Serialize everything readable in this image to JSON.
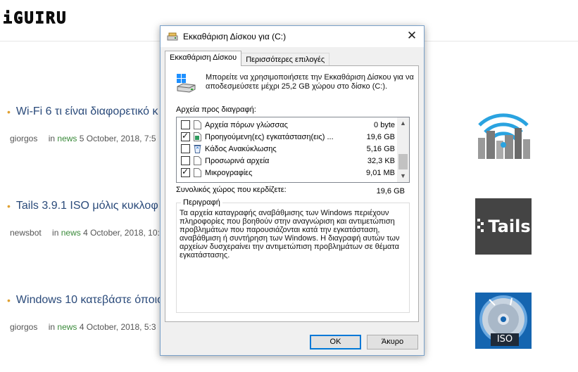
{
  "site": {
    "logo": "iGUIRU",
    "articles": [
      {
        "title": "Wi-Fi 6 τι είναι διαφορετικό κ",
        "author": "giorgos",
        "category_prefix": "in",
        "category": "news",
        "date": "5 October, 2018, 7:5"
      },
      {
        "title": "Tails 3.9.1 ISO μόλις κυκλοφ",
        "author": "newsbot",
        "category_prefix": "in",
        "category": "news",
        "date": "4 October, 2018, 10:"
      },
      {
        "title": "Windows 10 κατεβάστε όποιο",
        "author": "giorgos",
        "category_prefix": "in",
        "category": "news",
        "date": "4 October, 2018, 5:3"
      }
    ],
    "thumbnails": {
      "tails_text": "Tails",
      "iso_text": "ISO"
    }
  },
  "dialog": {
    "title": "Εκκαθάριση Δίσκου για  (C:)",
    "tabs": [
      {
        "label": "Εκκαθάριση Δίσκου",
        "active": true
      },
      {
        "label": "Περισσότερες επιλογές",
        "active": false
      }
    ],
    "intro_text": "Μπορείτε να χρησιμοποιήσετε την Εκκαθάριση Δίσκου για να αποδεσμεύσετε μέχρι 25,2 GB χώρου στο δίσκο  (C:).",
    "files_label": "Αρχεία προς διαγραφή:",
    "files": [
      {
        "name": "Αρχεία πόρων γλώσσας",
        "size": "0 byte",
        "checked": false,
        "icon": "file-icon"
      },
      {
        "name": "Προηγούμενη(ες) εγκατάσταση(εις) ...",
        "size": "19,6 GB",
        "checked": true,
        "icon": "windows-file-icon"
      },
      {
        "name": "Κάδος Ανακύκλωσης",
        "size": "5,16 GB",
        "checked": false,
        "icon": "recycle-bin-icon"
      },
      {
        "name": "Προσωρινά αρχεία",
        "size": "32,3 KB",
        "checked": false,
        "icon": "file-icon"
      },
      {
        "name": "Μικρογραφίες",
        "size": "9,01 MB",
        "checked": true,
        "icon": "file-icon"
      }
    ],
    "total_label": "Συνολικός χώρος που κερδίζετε:",
    "total_value": "19,6 GB",
    "description_label": "Περιγραφή",
    "description_text": "Τα αρχεία καταγραφής αναβάθμισης των Windows περιέχουν πληροφορίες που βοηθούν στην αναγνώριση και αντιμετώπιση προβλημάτων που παρουσιάζονται κατά την εγκατάσταση, αναβάθμιση ή συντήρηση των Windows. Η διαγραφή αυτών των αρχείων δυσχεραίνει την αντιμετώπιση προβλημάτων σε θέματα εγκατάστασης.",
    "ok_label": "OK",
    "cancel_label": "Άκυρο"
  },
  "colors": {
    "accent": "#0078d7",
    "link": "#2a4a7a",
    "bullet": "#e0a030"
  }
}
